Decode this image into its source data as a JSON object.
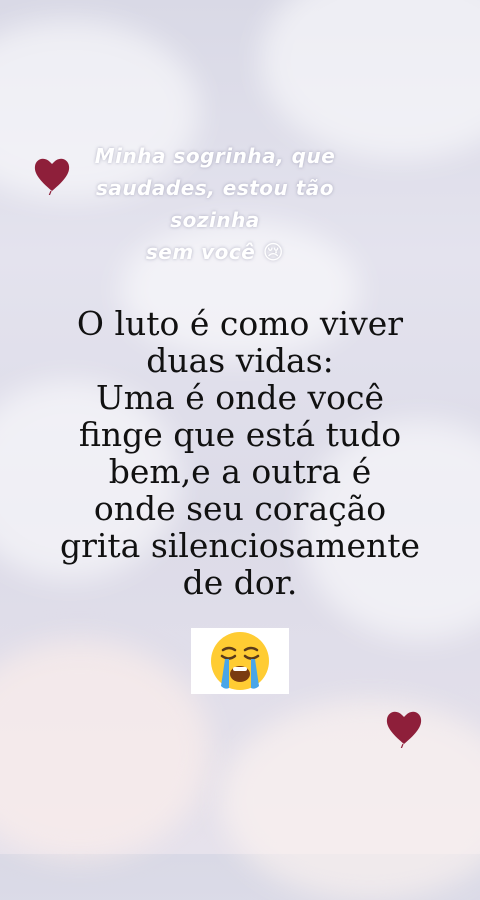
{
  "caption": {
    "line1": "Minha sogrinha, que",
    "line2": "saudades, estou tão sozinha",
    "line3": "sem você 😢"
  },
  "quote": {
    "line1": "O luto é como viver",
    "line2": "duas vidas:",
    "line3": "Uma é onde você",
    "line4": "finge que está tudo",
    "line5": "bem,e a outra é",
    "line6": "onde seu coração",
    "line7": "grita silenciosamente",
    "line8": "de dor."
  },
  "colors": {
    "heart": "#8e1f3a",
    "quote_text": "#111111",
    "caption_text": "#ffffff"
  },
  "icons": [
    "heart-icon",
    "loudly-crying-face-icon"
  ]
}
